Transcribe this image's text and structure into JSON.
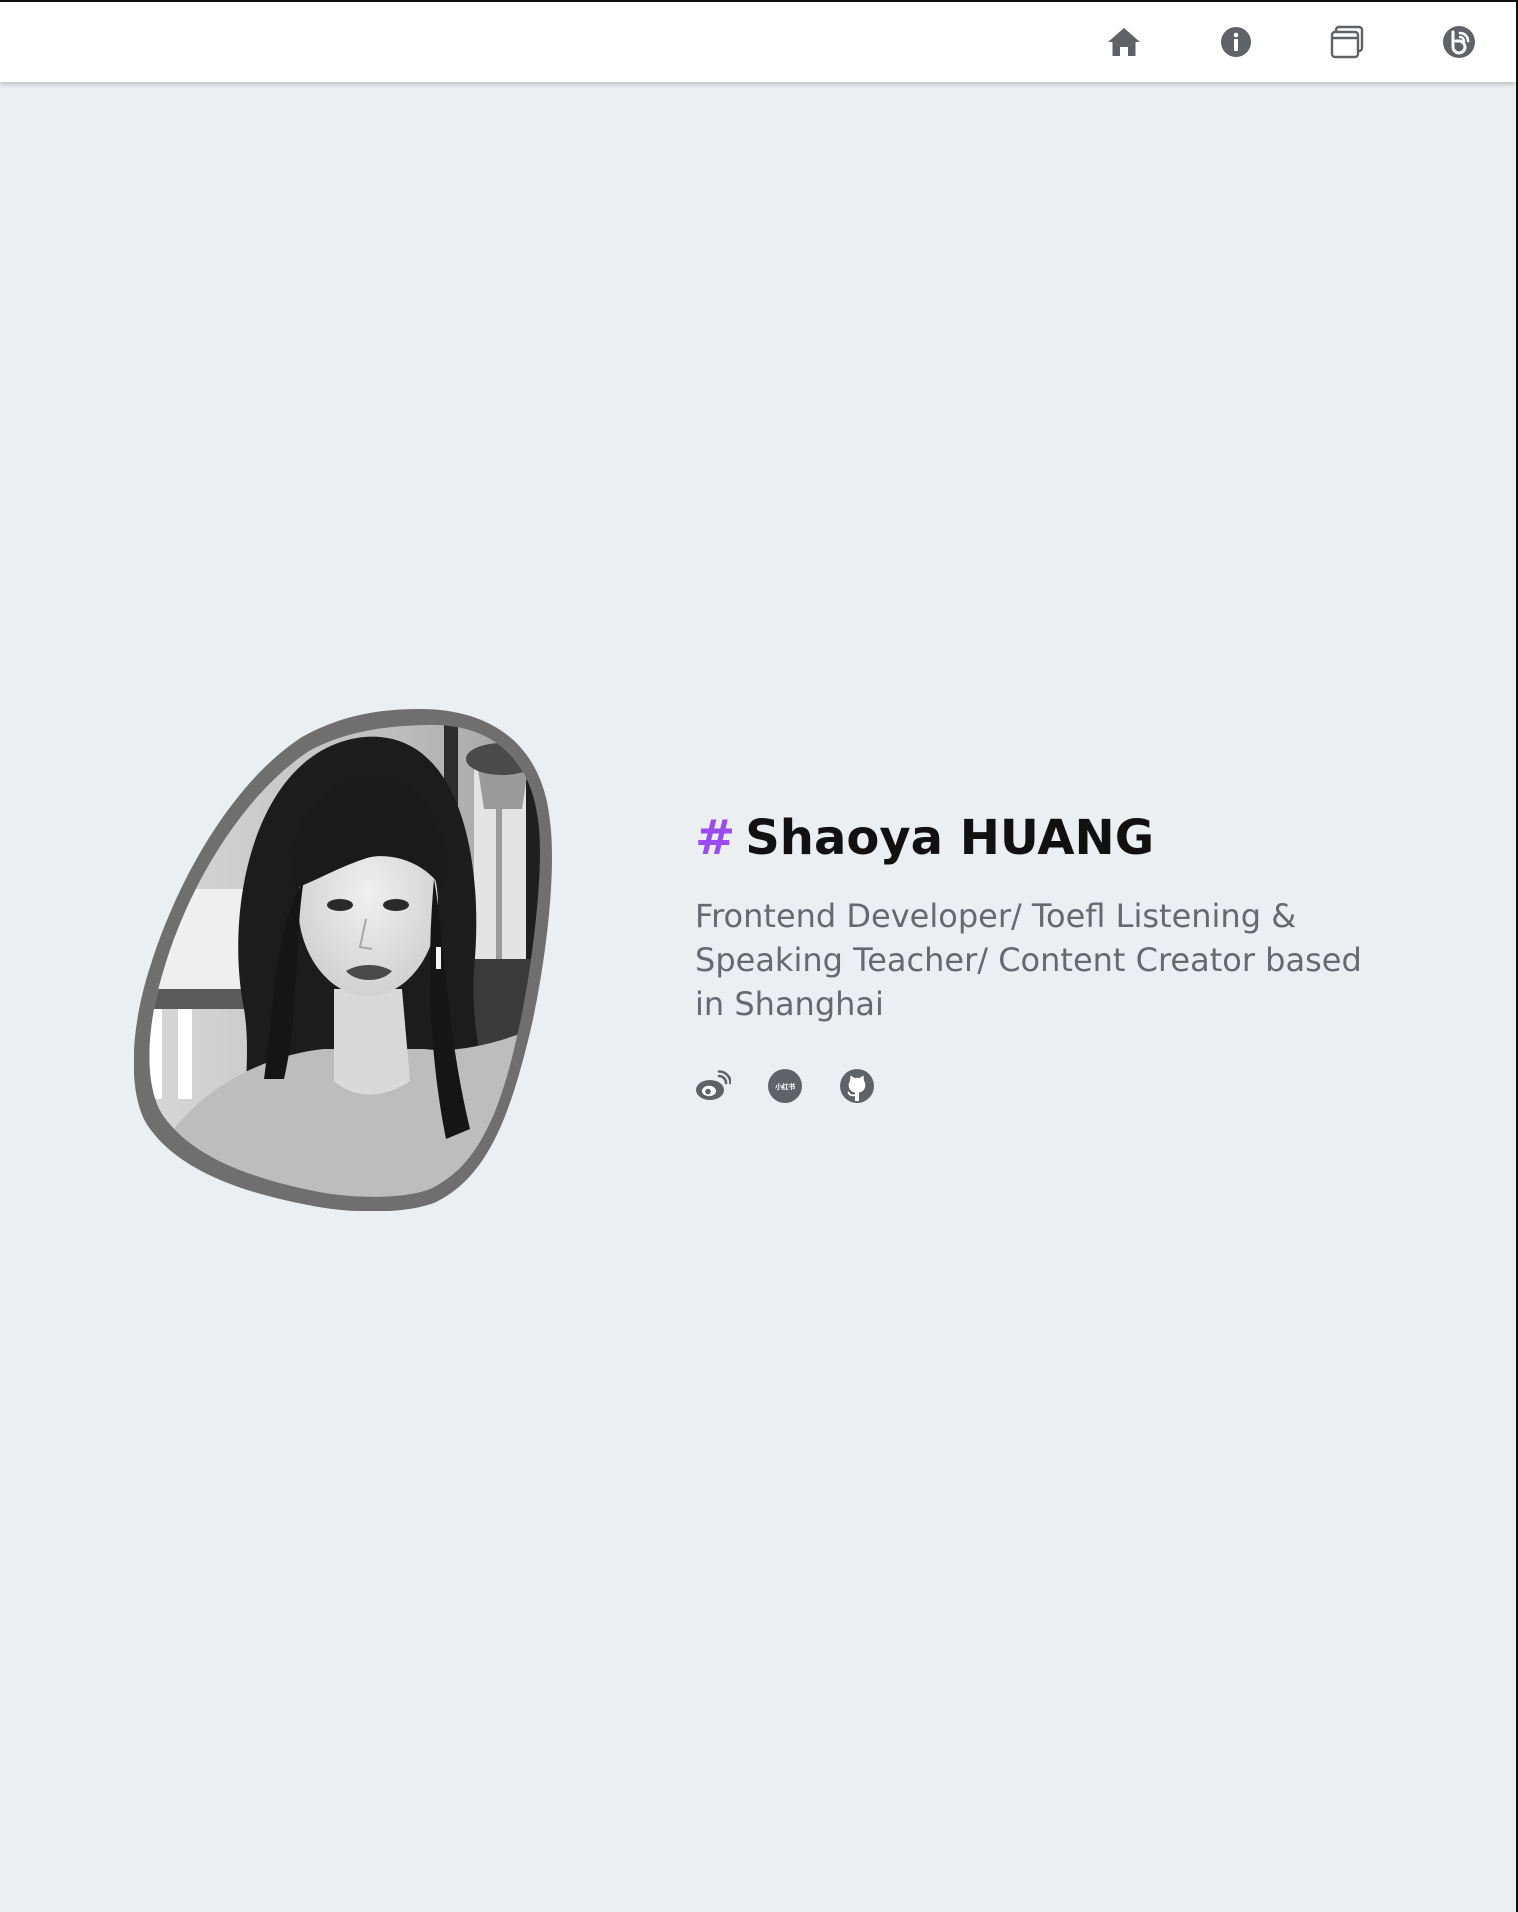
{
  "nav": {
    "items": [
      {
        "icon": "home-icon",
        "label": "Home"
      },
      {
        "icon": "info-icon",
        "label": "About"
      },
      {
        "icon": "window-icon",
        "label": "Projects"
      },
      {
        "icon": "blog-icon",
        "label": "Blog"
      }
    ],
    "icon_color": "#5f6368"
  },
  "profile": {
    "hash": "#",
    "name": "Shaoya HUANG",
    "bio": "Frontend Developer/ Toefl Listening & Speaking Teacher/ Content Creator based in Shanghai",
    "accent_color": "#9a4cf0"
  },
  "socials": [
    {
      "icon": "weibo-icon"
    },
    {
      "icon": "xiaohongshu-icon",
      "label": "小红书"
    },
    {
      "icon": "github-icon"
    }
  ],
  "colors": {
    "background": "#eceff2",
    "navbar": "#ffffff",
    "photo_border": "#6f6f6f"
  }
}
